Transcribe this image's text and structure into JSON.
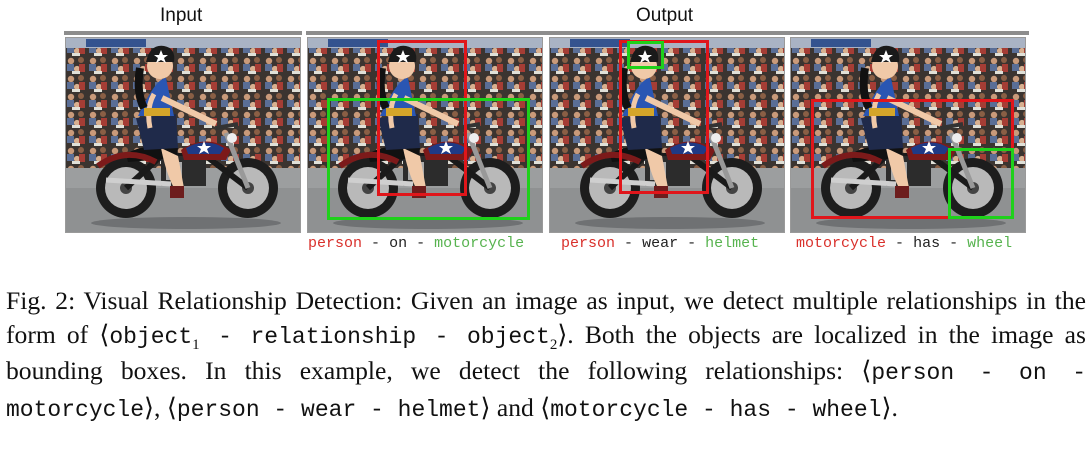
{
  "header": {
    "input_label": "Input",
    "output_label": "Output"
  },
  "panels": [
    {
      "id": "input"
    },
    {
      "id": "out1",
      "relation": {
        "subject": "person",
        "predicate": "on",
        "object": "motorcycle"
      }
    },
    {
      "id": "out2",
      "relation": {
        "subject": "person",
        "predicate": "wear",
        "object": "helmet"
      }
    },
    {
      "id": "out3",
      "relation": {
        "subject": "motorcycle",
        "predicate": "has",
        "object": "wheel"
      }
    }
  ],
  "separator": "-",
  "caption": {
    "fig_label": "Fig. 2:",
    "t1": " Visual Relationship Detection: Given an image as input, we detect multiple relationships in the form of ⟨",
    "o1": "object",
    "s1": "1",
    "mid": " - relationship - ",
    "o2": "object",
    "s2": "2",
    "t2": "⟩. Both the objects are localized in the image as bounding boxes. In this example, we detect the following relationships: ⟨",
    "r1": "person - on - motorcycle",
    "t3": "⟩, ⟨",
    "r2": "person - wear - helmet",
    "t4": "⟩ and ⟨",
    "r3": "motorcycle - has - wheel",
    "t5": "⟩."
  }
}
